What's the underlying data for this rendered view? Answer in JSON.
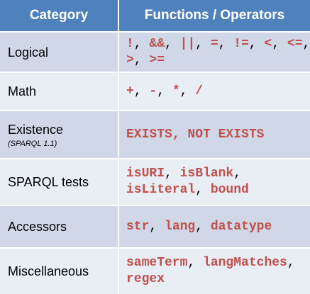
{
  "table": {
    "headers": {
      "category": "Category",
      "functions": "Functions / Operators"
    },
    "rows": [
      {
        "category": "Logical",
        "subnote": "",
        "ops_lines": [
          [
            {
              "t": "!",
              "k": "tok"
            },
            {
              "t": ", ",
              "k": "sep"
            },
            {
              "t": "&&",
              "k": "tok"
            },
            {
              "t": ", ",
              "k": "sep"
            },
            {
              "t": "||",
              "k": "tok"
            },
            {
              "t": ", ",
              "k": "sep"
            },
            {
              "t": "=",
              "k": "tok"
            },
            {
              "t": ", ",
              "k": "sep"
            },
            {
              "t": "!=",
              "k": "tok"
            },
            {
              "t": ", ",
              "k": "sep"
            },
            {
              "t": "<",
              "k": "tok"
            },
            {
              "t": ", ",
              "k": "sep"
            },
            {
              "t": "<=",
              "k": "tok"
            },
            {
              "t": ",",
              "k": "sep"
            }
          ],
          [
            {
              "t": ">",
              "k": "tok"
            },
            {
              "t": ", ",
              "k": "sep"
            },
            {
              "t": ">=",
              "k": "tok"
            }
          ]
        ]
      },
      {
        "category": "Math",
        "subnote": "",
        "ops_lines": [
          [
            {
              "t": "+",
              "k": "tok"
            },
            {
              "t": ", ",
              "k": "sep"
            },
            {
              "t": "-",
              "k": "tok"
            },
            {
              "t": ", ",
              "k": "sep"
            },
            {
              "t": "*",
              "k": "tok"
            },
            {
              "t": ", ",
              "k": "sep"
            },
            {
              "t": "/",
              "k": "tok"
            }
          ]
        ]
      },
      {
        "category": "Existence",
        "subnote": "(SPARQL 1.1)",
        "ops_lines": [
          [
            {
              "t": "EXISTS",
              "k": "tok"
            },
            {
              "t": ", ",
              "k": "tok"
            },
            {
              "t": "NOT EXISTS",
              "k": "tok"
            }
          ]
        ]
      },
      {
        "category": "SPARQL tests",
        "subnote": "",
        "ops_lines": [
          [
            {
              "t": "isURI",
              "k": "tok"
            },
            {
              "t": ", ",
              "k": "sep"
            },
            {
              "t": "isBlank",
              "k": "tok"
            },
            {
              "t": ",",
              "k": "sep"
            }
          ],
          [
            {
              "t": "isLiteral",
              "k": "tok"
            },
            {
              "t": ", ",
              "k": "sep"
            },
            {
              "t": "bound",
              "k": "tok"
            }
          ]
        ]
      },
      {
        "category": "Accessors",
        "subnote": "",
        "ops_lines": [
          [
            {
              "t": "str",
              "k": "tok"
            },
            {
              "t": ", ",
              "k": "sep"
            },
            {
              "t": "lang",
              "k": "tok"
            },
            {
              "t": ", ",
              "k": "sep"
            },
            {
              "t": "datatype",
              "k": "tok"
            }
          ]
        ]
      },
      {
        "category": "Miscellaneous",
        "subnote": "",
        "ops_lines": [
          [
            {
              "t": "sameTerm",
              "k": "tok"
            },
            {
              "t": ", ",
              "k": "sep"
            },
            {
              "t": "langMatches",
              "k": "tok"
            },
            {
              "t": ",",
              "k": "sep"
            }
          ],
          [
            {
              "t": "regex",
              "k": "tok"
            }
          ]
        ]
      }
    ]
  },
  "colors": {
    "header_bg": "#4f81bd",
    "band_dark": "#d0d8e8",
    "band_light": "#e9edf4",
    "operator_red": "#c0504d"
  }
}
